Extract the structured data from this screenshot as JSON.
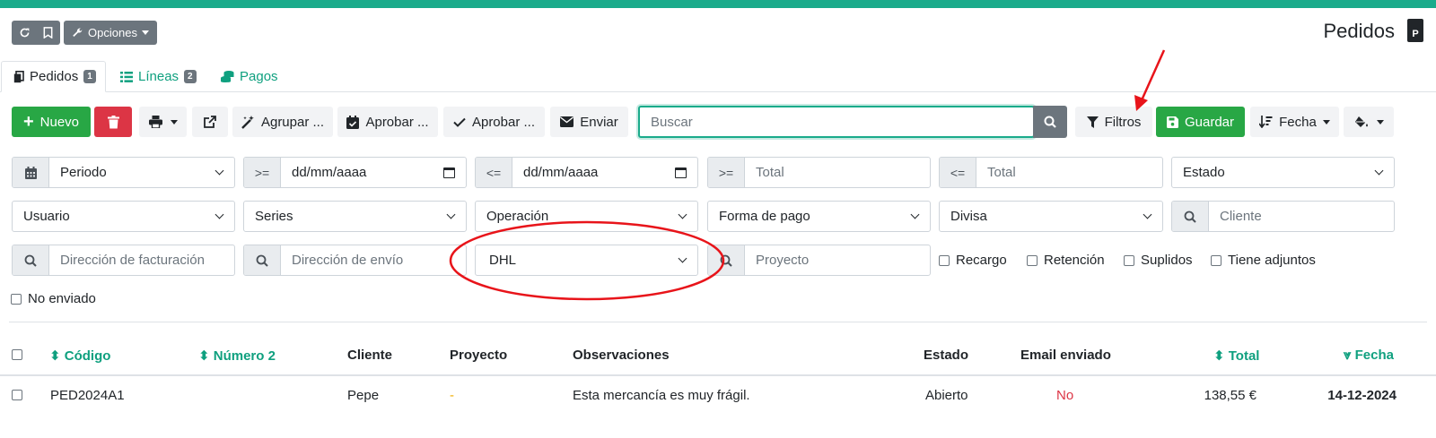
{
  "colors": {
    "accent": "#1aab8b",
    "link": "#0fa07f",
    "success": "#28a745",
    "danger": "#dc3545",
    "annotation": "#e8141a"
  },
  "header": {
    "options_label": "Opciones",
    "page_title": "Pedidos"
  },
  "tabs": [
    {
      "label": "Pedidos",
      "badge": "1",
      "icon": "copy-icon"
    },
    {
      "label": "Líneas",
      "badge": "2",
      "icon": "list-icon"
    },
    {
      "label": "Pagos",
      "icon": "coins-icon"
    }
  ],
  "toolbar": {
    "new_label": "Nuevo",
    "group_label": "Agrupar ...",
    "approve1_label": "Aprobar ...",
    "approve2_label": "Aprobar ...",
    "send_label": "Enviar",
    "search_placeholder": "Buscar",
    "filters_label": "Filtros",
    "save_label": "Guardar",
    "sort_label": "Fecha"
  },
  "filters": {
    "period": "Periodo",
    "gte_label": ">=",
    "lte_label": "<=",
    "date_placeholder": "dd/mm/aaaa",
    "total_placeholder": "Total",
    "estado": "Estado",
    "usuario": "Usuario",
    "series": "Series",
    "operacion": "Operación",
    "forma_pago": "Forma de pago",
    "divisa": "Divisa",
    "cliente_placeholder": "Cliente",
    "dir_facturacion_placeholder": "Dirección de facturación",
    "dir_envio_placeholder": "Dirección de envío",
    "carrier": "DHL",
    "proyecto_placeholder": "Proyecto",
    "checks": [
      "Recargo",
      "Retención",
      "Suplidos",
      "Tiene adjuntos",
      "No enviado"
    ]
  },
  "table": {
    "columns": [
      "Código",
      "Número 2",
      "Cliente",
      "Proyecto",
      "Observaciones",
      "Estado",
      "Email enviado",
      "Total",
      "Fecha"
    ],
    "rows": [
      {
        "codigo": "PED2024A1",
        "numero2": "",
        "cliente": "Pepe",
        "proyecto": "-",
        "observaciones": "Esta mercancía es muy frágil.",
        "estado": "Abierto",
        "email": "No",
        "total": "138,55 €",
        "fecha": "14-12-2024"
      }
    ]
  }
}
